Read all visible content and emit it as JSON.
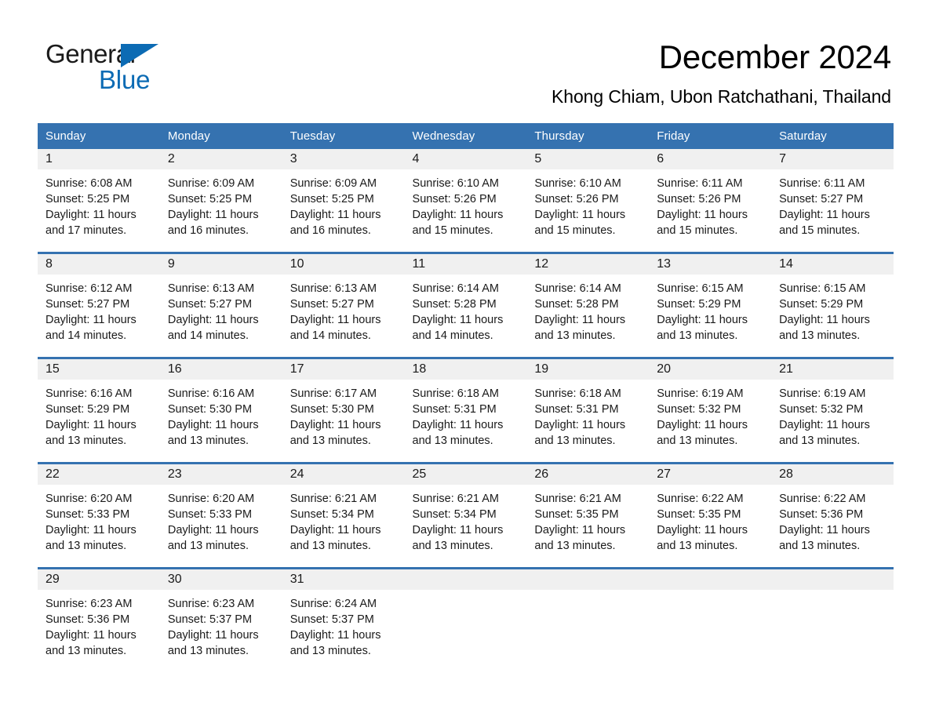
{
  "brand": {
    "logo_text_primary": "General",
    "logo_text_secondary": "Blue",
    "logo_triangle_icon": "triangle-icon",
    "accent_color": "#0c6bb4",
    "header_color": "#3572b0"
  },
  "header": {
    "title": "December 2024",
    "subtitle": "Khong Chiam, Ubon Ratchathani, Thailand"
  },
  "calendar": {
    "weekday_headers": [
      "Sunday",
      "Monday",
      "Tuesday",
      "Wednesday",
      "Thursday",
      "Friday",
      "Saturday"
    ],
    "weeks": [
      [
        {
          "date": "1",
          "sunrise": "Sunrise: 6:08 AM",
          "sunset": "Sunset: 5:25 PM",
          "daylight": "Daylight: 11 hours and 17 minutes."
        },
        {
          "date": "2",
          "sunrise": "Sunrise: 6:09 AM",
          "sunset": "Sunset: 5:25 PM",
          "daylight": "Daylight: 11 hours and 16 minutes."
        },
        {
          "date": "3",
          "sunrise": "Sunrise: 6:09 AM",
          "sunset": "Sunset: 5:25 PM",
          "daylight": "Daylight: 11 hours and 16 minutes."
        },
        {
          "date": "4",
          "sunrise": "Sunrise: 6:10 AM",
          "sunset": "Sunset: 5:26 PM",
          "daylight": "Daylight: 11 hours and 15 minutes."
        },
        {
          "date": "5",
          "sunrise": "Sunrise: 6:10 AM",
          "sunset": "Sunset: 5:26 PM",
          "daylight": "Daylight: 11 hours and 15 minutes."
        },
        {
          "date": "6",
          "sunrise": "Sunrise: 6:11 AM",
          "sunset": "Sunset: 5:26 PM",
          "daylight": "Daylight: 11 hours and 15 minutes."
        },
        {
          "date": "7",
          "sunrise": "Sunrise: 6:11 AM",
          "sunset": "Sunset: 5:27 PM",
          "daylight": "Daylight: 11 hours and 15 minutes."
        }
      ],
      [
        {
          "date": "8",
          "sunrise": "Sunrise: 6:12 AM",
          "sunset": "Sunset: 5:27 PM",
          "daylight": "Daylight: 11 hours and 14 minutes."
        },
        {
          "date": "9",
          "sunrise": "Sunrise: 6:13 AM",
          "sunset": "Sunset: 5:27 PM",
          "daylight": "Daylight: 11 hours and 14 minutes."
        },
        {
          "date": "10",
          "sunrise": "Sunrise: 6:13 AM",
          "sunset": "Sunset: 5:27 PM",
          "daylight": "Daylight: 11 hours and 14 minutes."
        },
        {
          "date": "11",
          "sunrise": "Sunrise: 6:14 AM",
          "sunset": "Sunset: 5:28 PM",
          "daylight": "Daylight: 11 hours and 14 minutes."
        },
        {
          "date": "12",
          "sunrise": "Sunrise: 6:14 AM",
          "sunset": "Sunset: 5:28 PM",
          "daylight": "Daylight: 11 hours and 13 minutes."
        },
        {
          "date": "13",
          "sunrise": "Sunrise: 6:15 AM",
          "sunset": "Sunset: 5:29 PM",
          "daylight": "Daylight: 11 hours and 13 minutes."
        },
        {
          "date": "14",
          "sunrise": "Sunrise: 6:15 AM",
          "sunset": "Sunset: 5:29 PM",
          "daylight": "Daylight: 11 hours and 13 minutes."
        }
      ],
      [
        {
          "date": "15",
          "sunrise": "Sunrise: 6:16 AM",
          "sunset": "Sunset: 5:29 PM",
          "daylight": "Daylight: 11 hours and 13 minutes."
        },
        {
          "date": "16",
          "sunrise": "Sunrise: 6:16 AM",
          "sunset": "Sunset: 5:30 PM",
          "daylight": "Daylight: 11 hours and 13 minutes."
        },
        {
          "date": "17",
          "sunrise": "Sunrise: 6:17 AM",
          "sunset": "Sunset: 5:30 PM",
          "daylight": "Daylight: 11 hours and 13 minutes."
        },
        {
          "date": "18",
          "sunrise": "Sunrise: 6:18 AM",
          "sunset": "Sunset: 5:31 PM",
          "daylight": "Daylight: 11 hours and 13 minutes."
        },
        {
          "date": "19",
          "sunrise": "Sunrise: 6:18 AM",
          "sunset": "Sunset: 5:31 PM",
          "daylight": "Daylight: 11 hours and 13 minutes."
        },
        {
          "date": "20",
          "sunrise": "Sunrise: 6:19 AM",
          "sunset": "Sunset: 5:32 PM",
          "daylight": "Daylight: 11 hours and 13 minutes."
        },
        {
          "date": "21",
          "sunrise": "Sunrise: 6:19 AM",
          "sunset": "Sunset: 5:32 PM",
          "daylight": "Daylight: 11 hours and 13 minutes."
        }
      ],
      [
        {
          "date": "22",
          "sunrise": "Sunrise: 6:20 AM",
          "sunset": "Sunset: 5:33 PM",
          "daylight": "Daylight: 11 hours and 13 minutes."
        },
        {
          "date": "23",
          "sunrise": "Sunrise: 6:20 AM",
          "sunset": "Sunset: 5:33 PM",
          "daylight": "Daylight: 11 hours and 13 minutes."
        },
        {
          "date": "24",
          "sunrise": "Sunrise: 6:21 AM",
          "sunset": "Sunset: 5:34 PM",
          "daylight": "Daylight: 11 hours and 13 minutes."
        },
        {
          "date": "25",
          "sunrise": "Sunrise: 6:21 AM",
          "sunset": "Sunset: 5:34 PM",
          "daylight": "Daylight: 11 hours and 13 minutes."
        },
        {
          "date": "26",
          "sunrise": "Sunrise: 6:21 AM",
          "sunset": "Sunset: 5:35 PM",
          "daylight": "Daylight: 11 hours and 13 minutes."
        },
        {
          "date": "27",
          "sunrise": "Sunrise: 6:22 AM",
          "sunset": "Sunset: 5:35 PM",
          "daylight": "Daylight: 11 hours and 13 minutes."
        },
        {
          "date": "28",
          "sunrise": "Sunrise: 6:22 AM",
          "sunset": "Sunset: 5:36 PM",
          "daylight": "Daylight: 11 hours and 13 minutes."
        }
      ],
      [
        {
          "date": "29",
          "sunrise": "Sunrise: 6:23 AM",
          "sunset": "Sunset: 5:36 PM",
          "daylight": "Daylight: 11 hours and 13 minutes."
        },
        {
          "date": "30",
          "sunrise": "Sunrise: 6:23 AM",
          "sunset": "Sunset: 5:37 PM",
          "daylight": "Daylight: 11 hours and 13 minutes."
        },
        {
          "date": "31",
          "sunrise": "Sunrise: 6:24 AM",
          "sunset": "Sunset: 5:37 PM",
          "daylight": "Daylight: 11 hours and 13 minutes."
        },
        {
          "date": "",
          "sunrise": "",
          "sunset": "",
          "daylight": ""
        },
        {
          "date": "",
          "sunrise": "",
          "sunset": "",
          "daylight": ""
        },
        {
          "date": "",
          "sunrise": "",
          "sunset": "",
          "daylight": ""
        },
        {
          "date": "",
          "sunrise": "",
          "sunset": "",
          "daylight": ""
        }
      ]
    ]
  }
}
